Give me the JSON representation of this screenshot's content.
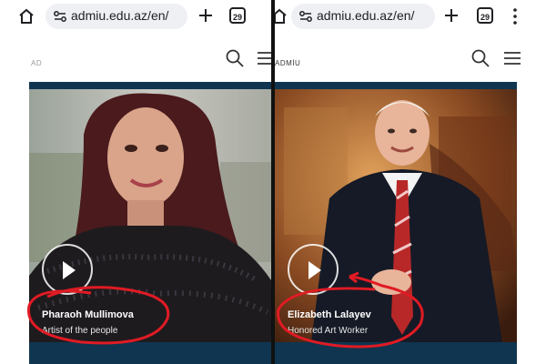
{
  "panels": [
    {
      "browser": {
        "url": "admiu.edu.az/en/",
        "tab_count": "29"
      },
      "site": {
        "logo": "AD"
      },
      "hero": {
        "name": "Pharaoh Mullimova",
        "title": "Artist of the people"
      }
    },
    {
      "browser": {
        "url": "admiu.edu.az/en/",
        "tab_count": "29"
      },
      "site": {
        "logo": "ADMİU"
      },
      "hero": {
        "name": "Elizabeth Lalayev",
        "title": "Honored Art Worker"
      }
    }
  ],
  "colors": {
    "hero_frame": "#0f3550",
    "annotation": "#e01b24",
    "url_pill": "#eef0f3"
  },
  "icons": [
    "home-icon",
    "site-settings-icon",
    "plus-icon",
    "tab-switcher-icon",
    "more-menu-icon",
    "search-icon",
    "hamburger-icon",
    "play-icon"
  ]
}
